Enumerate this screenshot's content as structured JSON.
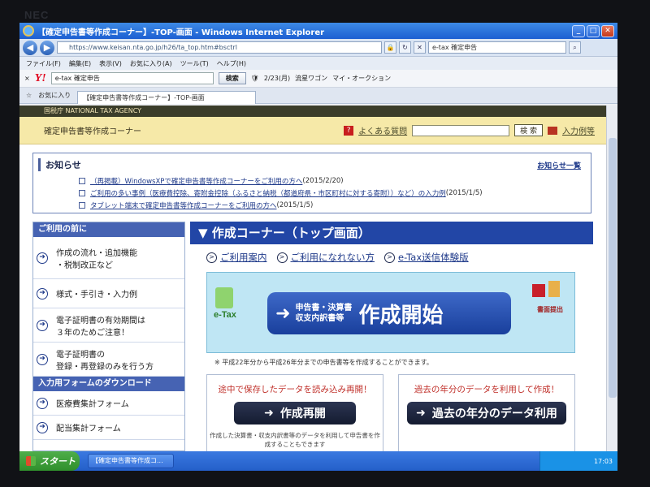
{
  "bezel": {
    "brand": "NEC"
  },
  "browser": {
    "window_title": "【確定申告書等作成コーナー】-TOP-画面 - Windows Internet Explorer",
    "url": "https://www.keisan.nta.go.jp/h26/ta_top.htm#bsctrl",
    "search_value": "e-tax 確定申告",
    "menu": [
      "ファイル(F)",
      "編集(E)",
      "表示(V)",
      "お気に入り(A)",
      "ツール(T)",
      "ヘルプ(H)"
    ],
    "yahoo_toolbar": {
      "search_value": "e-tax 確定申告",
      "search_button": "検索",
      "items": [
        "2/23(月)",
        "流星ワゴン",
        "マイ・オークション"
      ]
    },
    "favorites_label": "お気に入り",
    "tab_title": "【確定申告書等作成コーナー】-TOP-画面"
  },
  "site": {
    "agency": "国税庁  NATIONAL TAX AGENCY",
    "title": "確定申告書等作成コーナー",
    "faq": "よくある質問",
    "search_button": "検 索",
    "input_examples": "入力例等"
  },
  "news": {
    "heading": "お知らせ",
    "all_link": "お知らせ一覧",
    "items": [
      {
        "title": "（再掲載）WindowsXPで確定申告書等作成コーナーをご利用の方へ",
        "date": "(2015/2/20)"
      },
      {
        "title": "ご利用の多い事例（医療費控除、寄附金控除（ふるさと納税（都道府県・市区町村に対する寄附））など）の入力例",
        "date": "(2015/1/5)"
      },
      {
        "title": "タブレット端末で確定申告書等作成コーナーをご利用の方へ",
        "date": "(2015/1/5)"
      }
    ]
  },
  "sidebar": {
    "section1": "ご利用の前に",
    "items1": [
      [
        "作成の流れ・追加機能",
        "・税制改正など"
      ],
      [
        "様式・手引き・入力例"
      ],
      [
        "電子証明書の有効期間は",
        "３年のためご注意！"
      ],
      [
        "電子証明書の",
        "登録・再登録のみを行う方"
      ]
    ],
    "section2": "入力用フォームのダウンロード",
    "items2": [
      "医療費集計フォーム",
      "配当集計フォーム"
    ]
  },
  "main": {
    "heading": "▼ 作成コーナー（トップ画面）",
    "links": [
      "ご利用案内",
      "ご利用になれない方",
      "e-Tax送信体験版"
    ],
    "start_small": [
      "申告書・決算書",
      "収支内訳書等"
    ],
    "start_big": "作成開始",
    "etax_label": "e-Tax",
    "paper_label": "書面提出",
    "note": "※  平成22年分から平成26年分までの申告書等を作成することができます。",
    "resume": {
      "head": "途中で保存したデータを読み込み再開！",
      "button": "作成再開",
      "desc": "作成した決算書・収支内訳書等のデータを利用して申告書を作成することもできます"
    },
    "past": {
      "head": "過去の年分のデータを利用して作成！",
      "button": "過去の年分のデータ利用"
    }
  },
  "taskbar": {
    "start": "スタート",
    "task": "【確定申告書等作成コ...",
    "clock": "17:03"
  }
}
